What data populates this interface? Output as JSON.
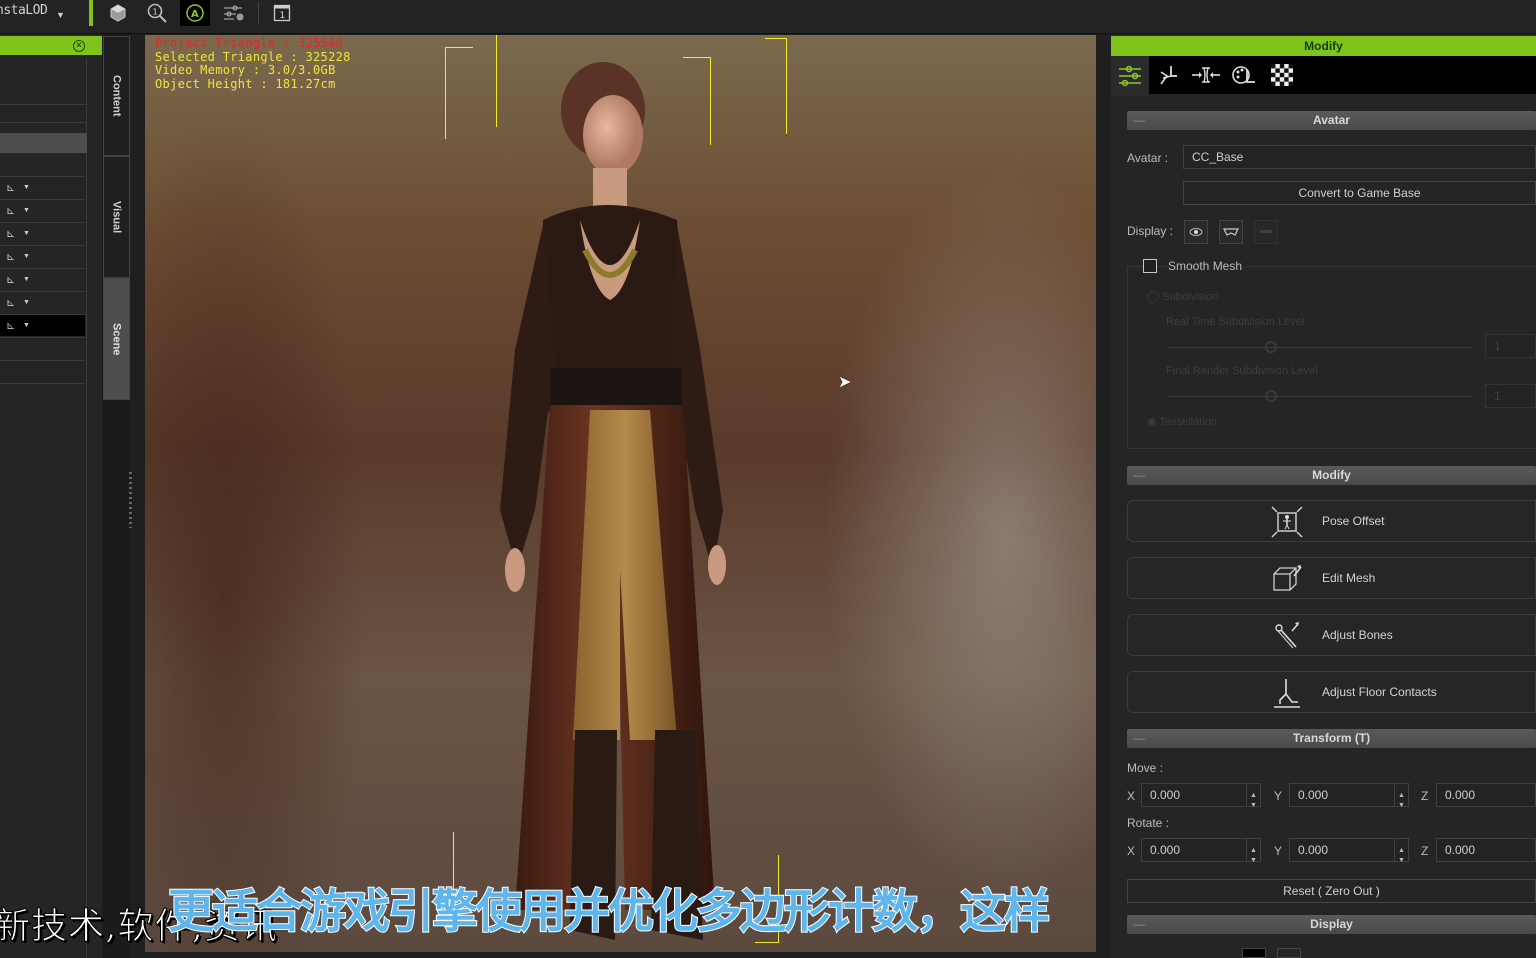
{
  "toolbar": {
    "plugin_label": "nstaLOD",
    "icons": [
      "cube-icon",
      "search-figure-icon",
      "auto-a-icon",
      "settings-sliders-icon",
      "panel-icon"
    ]
  },
  "left_panel": {
    "rows": 7,
    "tabs": [
      "Content",
      "Visual",
      "Scene"
    ],
    "active_tab": "Scene"
  },
  "viewport": {
    "stats": {
      "project_triangle": "Project Triangle : 325540",
      "selected_triangle": "Selected Triangle : 325228",
      "video_memory": "Video Memory : 3.0/3.0GB",
      "object_height": "Object Height : 181.27cm"
    }
  },
  "modify_panel": {
    "title": "Modify",
    "tabs": [
      "attributes-tab",
      "motion-tab",
      "morph-tab",
      "material-tab",
      "texture-tab"
    ],
    "avatar_section": {
      "title": "Avatar",
      "avatar_label": "Avatar :",
      "avatar_value": "CC_Base",
      "convert_button": "Convert to Game Base",
      "display_label": "Display :",
      "smooth_mesh_label": "Smooth Mesh",
      "smooth_mesh_checked": false,
      "subdivision_label": "Subdivision",
      "realtime_level_label": "Real Time Subdivision Level",
      "realtime_level_value": "1",
      "render_level_label": "Final Render Subdivision Level",
      "render_level_value": "1",
      "tessellation_label": "Tessellation"
    },
    "modify_section": {
      "title": "Modify",
      "buttons": [
        "Pose Offset",
        "Edit Mesh",
        "Adjust Bones",
        "Adjust Floor Contacts"
      ]
    },
    "transform_section": {
      "title": "Transform  (T)",
      "move_label": "Move :",
      "rotate_label": "Rotate :",
      "move": {
        "x": "0.000",
        "y": "0.000",
        "z": "0.000"
      },
      "rotate": {
        "x": "0.000",
        "y": "0.000",
        "z": "0.000"
      },
      "axis_x": "X",
      "axis_y": "Y",
      "axis_z": "Z",
      "reset_button": "Reset ( Zero Out )"
    },
    "display_section": {
      "title": "Display"
    }
  },
  "subtitles": {
    "background_line": "新技术,软件,资讯",
    "foreground_line": "更适合游戏引擎使用并优化多边形计数，这样"
  },
  "colors": {
    "accent_green": "#7fc31c",
    "stat_yellow": "#f0e63a",
    "stat_red": "#e0262a",
    "subtitle_blue": "#5fb6ec"
  }
}
